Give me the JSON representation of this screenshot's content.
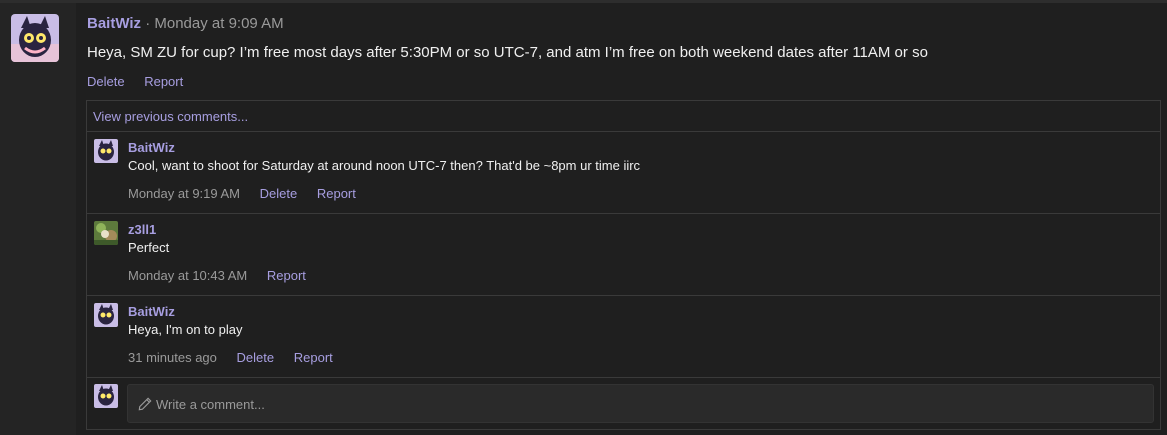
{
  "post": {
    "author": "BaitWiz",
    "separator": "·",
    "timestamp": "Monday at 9:09 AM",
    "body": "Heya, SM ZU for cup? I’m free most days after 5:30PM or so UTC-7, and atm I’m free on both weekend dates after 11AM or so",
    "actions": {
      "delete": "Delete",
      "report": "Report"
    }
  },
  "comments": {
    "view_previous": "View previous comments...",
    "items": [
      {
        "author": "BaitWiz",
        "text": "Cool, want to shoot for Saturday at around noon UTC-7 then? That'd be ~8pm ur time iirc",
        "time": "Monday at 9:19 AM",
        "delete": "Delete",
        "report": "Report"
      },
      {
        "author": "z3ll1",
        "text": "Perfect",
        "time": "Monday at 10:43 AM",
        "report": "Report"
      },
      {
        "author": "BaitWiz",
        "text": "Heya, I'm on to play",
        "time": "31 minutes ago",
        "delete": "Delete",
        "report": "Report"
      }
    ],
    "write_placeholder": "Write a comment..."
  },
  "colors": {
    "background": "#1f1f1f",
    "accent": "#a79ee0",
    "muted": "#9a9a9a",
    "border": "#3a3a3a"
  }
}
